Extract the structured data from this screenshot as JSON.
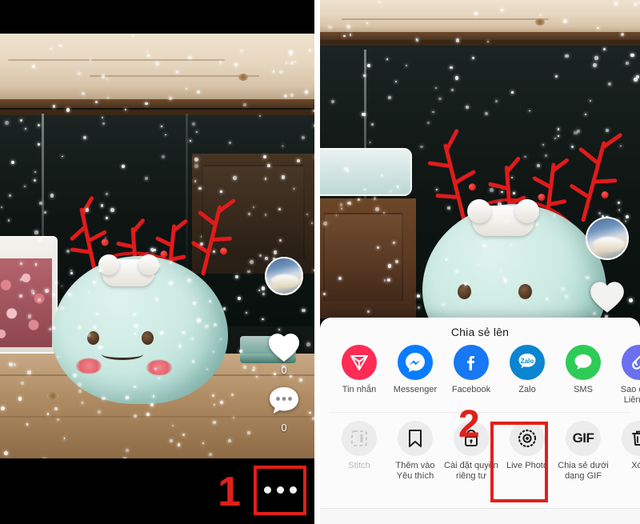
{
  "app": {
    "name": "TikTok video player",
    "language": "vi"
  },
  "left_panel": {
    "name": "Video playing with controls",
    "rail": {
      "avatar_label": "profile-avatar",
      "like_count": "0",
      "comment_count": "0",
      "more_label": "more-options"
    },
    "annotation": {
      "step_number": "1",
      "color": "#e0201b"
    }
  },
  "right_panel": {
    "name": "Video with share sheet open",
    "rail": {
      "avatar_label": "profile-avatar"
    },
    "annotation": {
      "step_number": "2",
      "color": "#e0201b"
    },
    "share_sheet": {
      "title": "Chia sẻ lên",
      "apps": [
        {
          "label": "Tin nhắn",
          "icon": "paper-plane-icon",
          "color": "#fe2c55"
        },
        {
          "label": "Messenger",
          "icon": "messenger-icon",
          "color": "#0a7cff"
        },
        {
          "label": "Facebook",
          "icon": "facebook-icon",
          "color": "#1877f2"
        },
        {
          "label": "Zalo",
          "icon": "zalo-icon",
          "color": "#0a85d1",
          "badge": "Zalo"
        },
        {
          "label": "SMS",
          "icon": "sms-icon",
          "color": "#2ecc56"
        },
        {
          "label": "Sao chép\nLiên kết",
          "icon": "copy-link-icon",
          "color": "#6a70ef"
        }
      ],
      "actions": [
        {
          "label": "Stitch",
          "icon": "stitch-icon",
          "disabled": true
        },
        {
          "label": "Thêm vào\nYêu thích",
          "icon": "bookmark-icon",
          "disabled": false
        },
        {
          "label": "Cài đặt quyền\nriêng tư",
          "icon": "lock-icon",
          "disabled": false
        },
        {
          "label": "Live Photo",
          "icon": "live-photo-icon",
          "disabled": false,
          "highlighted": true
        },
        {
          "label": "Chia sẻ dưới\ndạng GIF",
          "icon": "gif-icon",
          "disabled": false
        },
        {
          "label": "Xóa",
          "icon": "trash-icon",
          "disabled": false
        }
      ]
    }
  },
  "scene": {
    "description": "Mint-green plush toy with red reindeer antlers on a wooden shelf, snow particle effect"
  }
}
